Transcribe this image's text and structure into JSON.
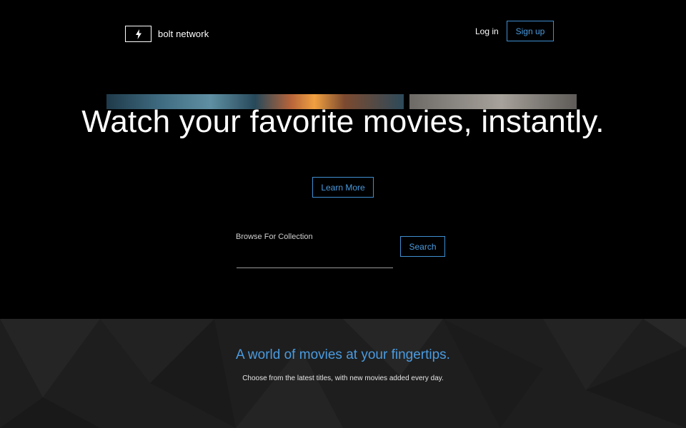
{
  "header": {
    "logo_text": "bolt network",
    "login_label": "Log in",
    "signup_label": "Sign up"
  },
  "hero": {
    "title": "Watch your favorite movies, instantly.",
    "learn_more_label": "Learn More"
  },
  "search": {
    "label": "Browse For Collection",
    "value": "",
    "placeholder": "",
    "button_label": "Search"
  },
  "section": {
    "title": "A world of movies at your fingertips.",
    "subtitle": "Choose from the latest titles, with new movies added every day."
  },
  "icons": {
    "logo": "lightning-bolt-icon"
  },
  "colors": {
    "background": "#000000",
    "accent": "#4a9be0",
    "section_background": "#1f1f1f",
    "text": "#ffffff"
  }
}
